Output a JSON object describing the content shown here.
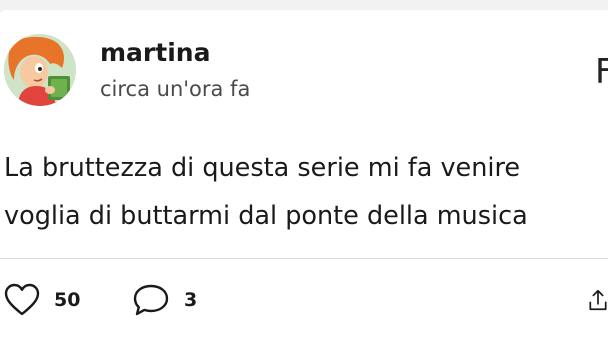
{
  "post": {
    "author": "martina",
    "time": "circa un'ora fa",
    "header_action_partial": "F",
    "text": "La bruttezza di questa serie mi fa venire voglia di buttarmi dal ponte della musica"
  },
  "actions": {
    "like_icon": "heart-outline-icon",
    "likes": "50",
    "comment_icon": "speech-bubble-icon",
    "comments": "3",
    "share_icon": "share-upload-icon"
  },
  "colors": {
    "background": "#f2f2f2",
    "card": "#ffffff",
    "text": "#1a1a1a",
    "muted": "#4a4a4a",
    "divider": "#d9d9d9"
  }
}
